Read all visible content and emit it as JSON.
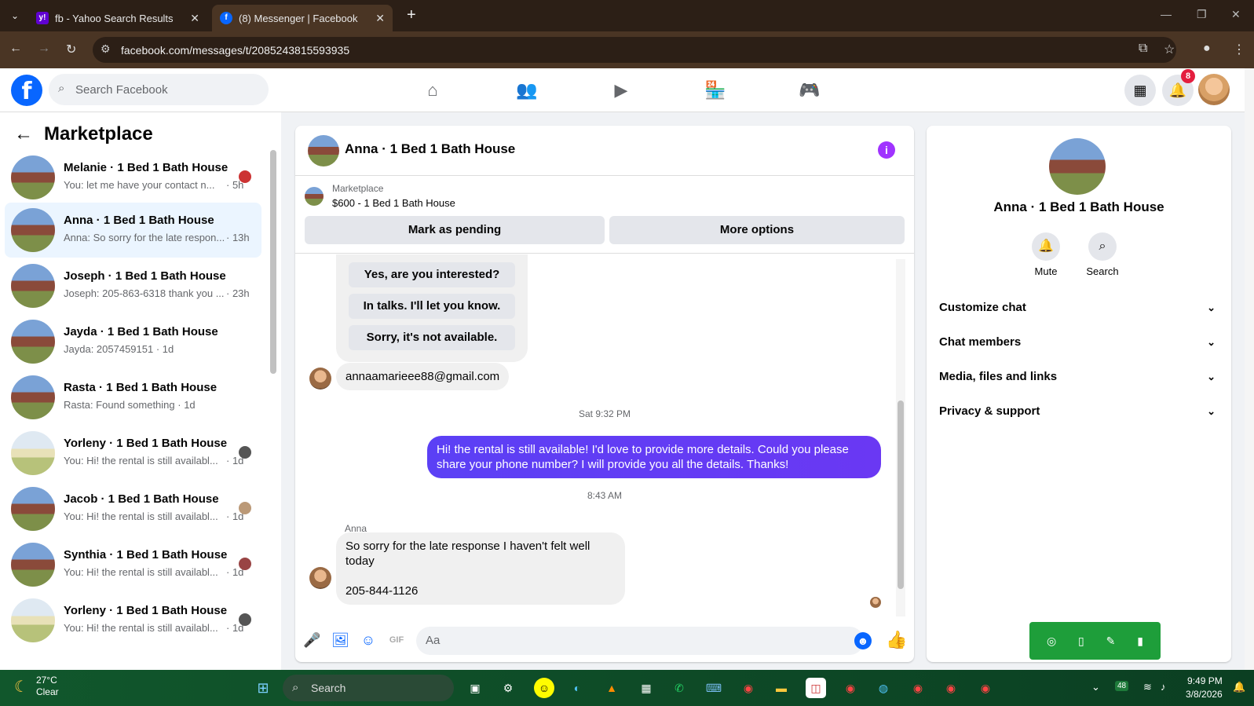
{
  "browser": {
    "tabs": [
      {
        "title": "fb - Yahoo Search Results",
        "icon": "yahoo-icon"
      },
      {
        "title": "(8) Messenger | Facebook",
        "icon": "facebook-icon"
      }
    ],
    "url": "facebook.com/messages/t/2085243815593935"
  },
  "fb": {
    "search_placeholder": "Search Facebook",
    "notifications_count": "8"
  },
  "sidebar": {
    "title": "Marketplace",
    "conversations": [
      {
        "name": "Melanie · 1 Bed 1 Bath House",
        "preview": "You: let me have your contact n...",
        "time": "· 5h"
      },
      {
        "name": "Anna · 1 Bed 1 Bath House",
        "preview": "Anna: So sorry for the late respon...",
        "time": "· 13h"
      },
      {
        "name": "Joseph · 1 Bed 1 Bath House",
        "preview": "Joseph: 205-863-6318 thank you ...",
        "time": "· 23h"
      },
      {
        "name": "Jayda · 1 Bed 1 Bath House",
        "preview": "Jayda: 2057459151 · 1d",
        "time": ""
      },
      {
        "name": "Rasta · 1 Bed 1 Bath House",
        "preview": "Rasta: Found something · 1d",
        "time": ""
      },
      {
        "name": "Yorleny · 1 Bed 1 Bath House",
        "preview": "You: Hi! the rental is still availabl...",
        "time": "· 1d"
      },
      {
        "name": "Jacob · 1 Bed 1 Bath House",
        "preview": "You: Hi! the rental is still availabl...",
        "time": "· 1d"
      },
      {
        "name": "Synthia · 1 Bed 1 Bath House",
        "preview": "You: Hi! the rental is still availabl...",
        "time": "· 1d"
      },
      {
        "name": "Yorleny · 1 Bed 1 Bath House",
        "preview": "You: Hi! the rental is still availabl...",
        "time": "· 1d"
      }
    ]
  },
  "chat": {
    "title": "Anna · 1 Bed 1 Bath House",
    "marketplace_label": "Marketplace",
    "listing": "$600 - 1 Bed 1 Bath House",
    "mark_pending": "Mark as pending",
    "more_options": "More options",
    "quick_replies": [
      "Yes, are you interested?",
      "In talks. I'll let you know.",
      "Sorry, it's not available."
    ],
    "email_msg": "annaamarieee88@gmail.com",
    "stamp1": "Sat 9:32 PM",
    "out_msg": "Hi! the rental is still available! I'd love to provide more details. Could you please share your phone number? I will provide you all the details. Thanks!",
    "stamp2": "8:43 AM",
    "sender": "Anna",
    "in_msg_line1": "So sorry for the late response I haven't felt well today",
    "in_msg_line2": "205-844-1126",
    "composer_placeholder": "Aa"
  },
  "info_panel": {
    "name": "Anna · 1 Bed 1 Bath House",
    "mute": "Mute",
    "search": "Search",
    "rows": [
      "Customize chat",
      "Chat members",
      "Media, files and links",
      "Privacy & support"
    ]
  },
  "taskbar": {
    "temp": "27°C",
    "condition": "Clear",
    "search": "Search",
    "battery_label": "48",
    "time": "9:49 PM",
    "date": "3/8/2026"
  }
}
